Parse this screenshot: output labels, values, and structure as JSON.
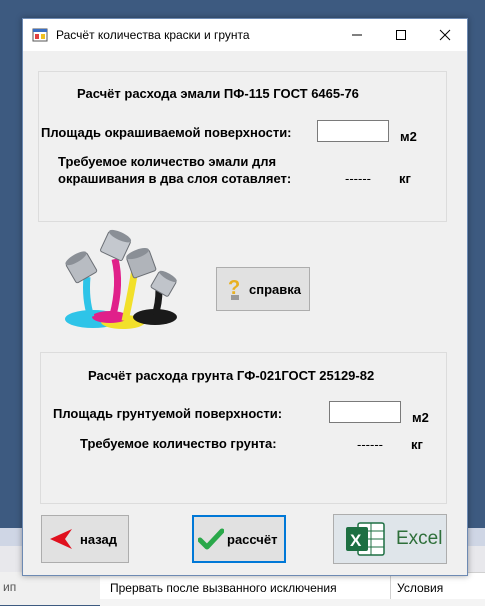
{
  "window": {
    "title": "Расчёт количества краски и грунта",
    "minimize_glyph": "—",
    "maximize_glyph": "☐",
    "close_glyph": "✕"
  },
  "enamel": {
    "heading": "Расчёт расхода эмали ПФ-115 ГОСТ 6465-76",
    "area_label": "Площадь окрашиваемой поверхности:",
    "area_value": "",
    "area_unit": "м2",
    "result_label": "Требуемое количество эмали для окрашивания в два слоя сотавляет:",
    "result_value": "------",
    "result_unit": "кг"
  },
  "help_button": {
    "label": "справка",
    "icon": "question-bulb-icon"
  },
  "primer": {
    "heading": "Расчёт расхода грунта ГФ-021ГОСТ 25129-82",
    "area_label": "Площадь грунтуемой поверхности:",
    "area_value": "",
    "area_unit": "м2",
    "result_label": "Требуемое количество грунта:",
    "result_value": "------",
    "result_unit": "кг"
  },
  "buttons": {
    "back": {
      "label": "назад",
      "icon": "red-arrow-left-icon"
    },
    "calculate": {
      "label": "рассчёт",
      "icon": "green-check-icon"
    },
    "excel": {
      "label": "Excel",
      "icon": "excel-icon"
    }
  },
  "background": {
    "left_text": "ип",
    "table_col1": "Прервать после вызванного исключения",
    "table_col2": "Условия"
  },
  "colors": {
    "cyan": "#2ec4e8",
    "magenta": "#e0208a",
    "yellow": "#f2e02a",
    "black": "#1a1a1a",
    "excel_green": "#1d6f42",
    "focus_blue": "#0078d7"
  }
}
